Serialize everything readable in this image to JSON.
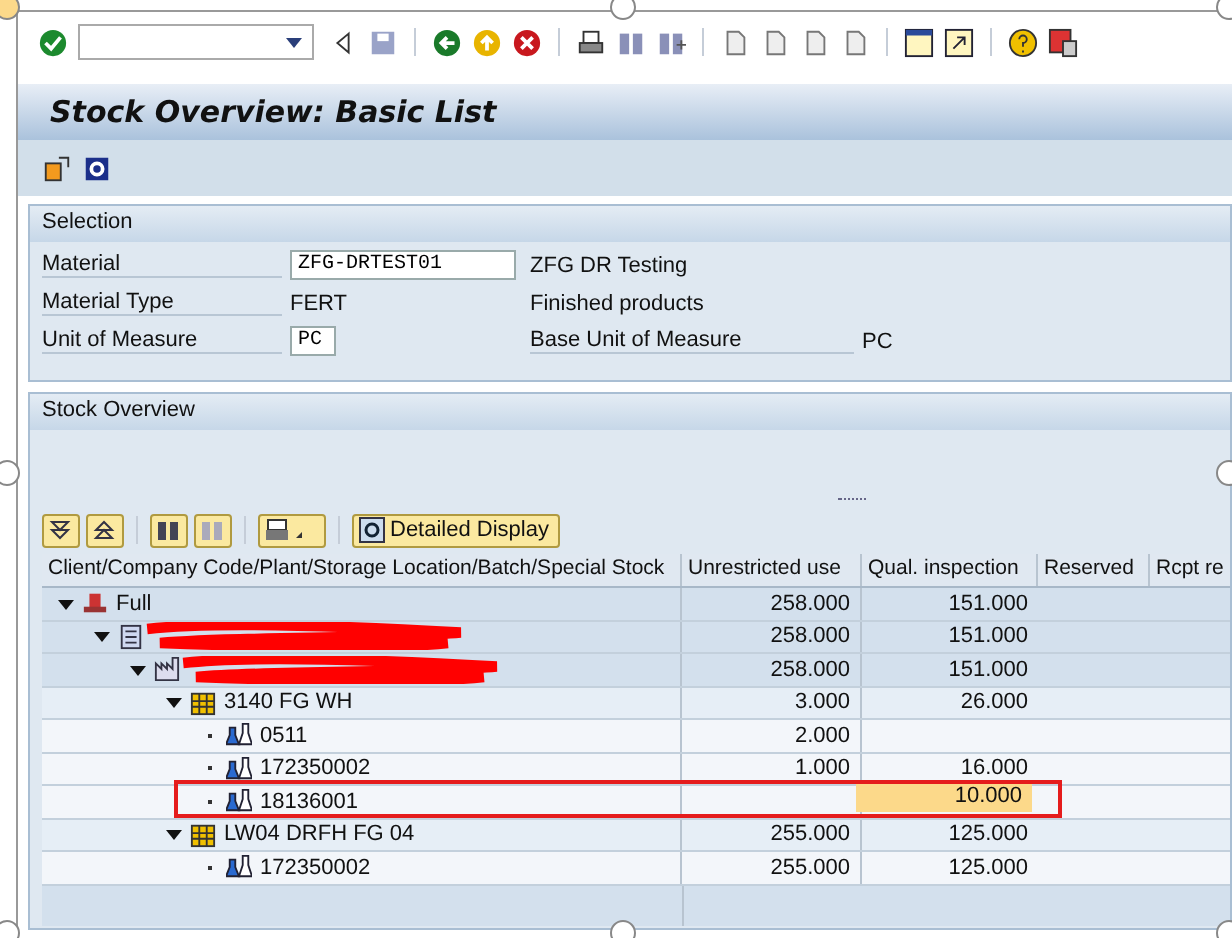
{
  "title": "Stock Overview: Basic List",
  "selection": {
    "heading": "Selection",
    "material": {
      "label": "Material",
      "value": "ZFG-DRTEST01",
      "description": "ZFG DR Testing"
    },
    "material_type": {
      "label": "Material Type",
      "value": "FERT",
      "description": "Finished products"
    },
    "unit": {
      "label": "Unit of Measure",
      "value": "PC",
      "base_label": "Base Unit of Measure",
      "base_value": "PC"
    }
  },
  "stock": {
    "heading": "Stock Overview",
    "detail_button": "Detailed Display",
    "columns": [
      "Client/Company Code/Plant/Storage Location/Batch/Special Stock",
      "Unrestricted use",
      "Qual. inspection",
      "Reserved",
      "Rcpt re"
    ],
    "rows": [
      {
        "kind": "client",
        "label": "Full",
        "expanded": true,
        "unrestricted": "258.000",
        "qual": "151.000",
        "children": [
          {
            "kind": "company",
            "redacted": true,
            "expanded": true,
            "unrestricted": "258.000",
            "qual": "151.000",
            "children": [
              {
                "kind": "plant",
                "redacted": true,
                "expanded": true,
                "unrestricted": "258.000",
                "qual": "151.000",
                "children": [
                  {
                    "kind": "storage",
                    "label": "3140 FG WH",
                    "expanded": true,
                    "unrestricted": "3.000",
                    "qual": "26.000",
                    "children": [
                      {
                        "kind": "batch",
                        "label": "0511",
                        "unrestricted": "2.000"
                      },
                      {
                        "kind": "batch",
                        "label": "172350002",
                        "unrestricted": "1.000",
                        "qual": "16.000"
                      },
                      {
                        "kind": "batch",
                        "label": "18136001",
                        "qual": "10.000",
                        "qual_highlighted": true,
                        "outlined": true
                      }
                    ]
                  },
                  {
                    "kind": "storage",
                    "label": "LW04 DRFH FG 04",
                    "expanded": true,
                    "unrestricted": "255.000",
                    "qual": "125.000",
                    "children": [
                      {
                        "kind": "batch",
                        "label": "172350002",
                        "unrestricted": "255.000",
                        "qual": "125.000"
                      }
                    ]
                  }
                ]
              }
            ]
          }
        ]
      }
    ]
  }
}
